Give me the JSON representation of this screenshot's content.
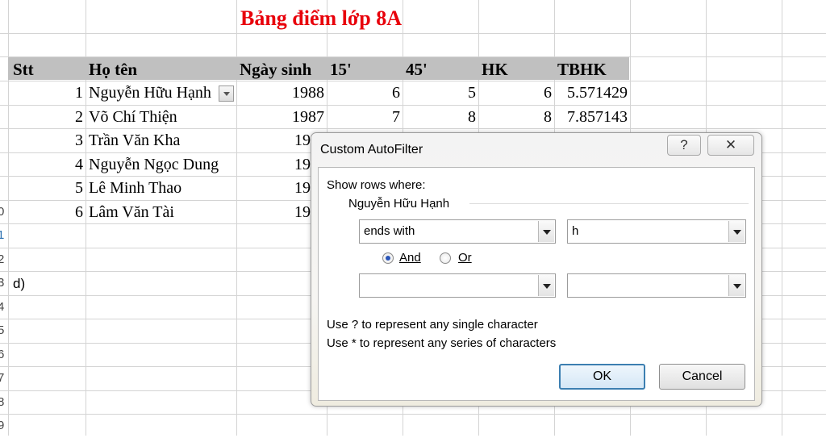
{
  "sheet": {
    "title": "Bảng điểm lớp 8A",
    "row_numbers": [
      "0",
      "1",
      "2",
      "3",
      "4",
      "5",
      "6",
      "7",
      "8",
      "9"
    ],
    "headers": [
      "Stt",
      "Họ tên",
      "Ngày sinh",
      "15'",
      "45'",
      "HK",
      "TBHK"
    ],
    "rows": [
      {
        "stt": "1",
        "name": "Nguyễn Hữu Hạnh",
        "birth": "1988",
        "m15": "6",
        "m45": "5",
        "hk": "6",
        "tbhk": "5.571429"
      },
      {
        "stt": "2",
        "name": "Võ Chí Thiện",
        "birth": "1987",
        "m15": "7",
        "m45": "8",
        "hk": "8",
        "tbhk": "7.857143"
      },
      {
        "stt": "3",
        "name": "Trần Văn Kha",
        "birth": "19"
      },
      {
        "stt": "4",
        "name": "Nguyễn Ngọc Dung",
        "birth": "19"
      },
      {
        "stt": "5",
        "name": "Lê Minh Thao",
        "birth": "19"
      },
      {
        "stt": "6",
        "name": "Lâm Văn Tài",
        "birth": "19"
      }
    ],
    "note_label": "d)"
  },
  "dialog": {
    "title": "Custom AutoFilter",
    "help_glyph": "?",
    "close_glyph": "✕",
    "show_rows_label": "Show rows where:",
    "field_name": "Nguyễn Hữu Hạnh",
    "condition1": {
      "operator": "ends with",
      "value": "h"
    },
    "logic": {
      "and_label": "And",
      "or_label": "Or",
      "selected": "And"
    },
    "condition2": {
      "operator": "",
      "value": ""
    },
    "hint1": "Use ? to represent any single character",
    "hint2": "Use * to represent any series of characters",
    "ok_label": "OK",
    "cancel_label": "Cancel"
  },
  "colors": {
    "title": "#e8000b",
    "header_bg": "#c0c0c0",
    "default_button_border": "#3c7fb1"
  }
}
